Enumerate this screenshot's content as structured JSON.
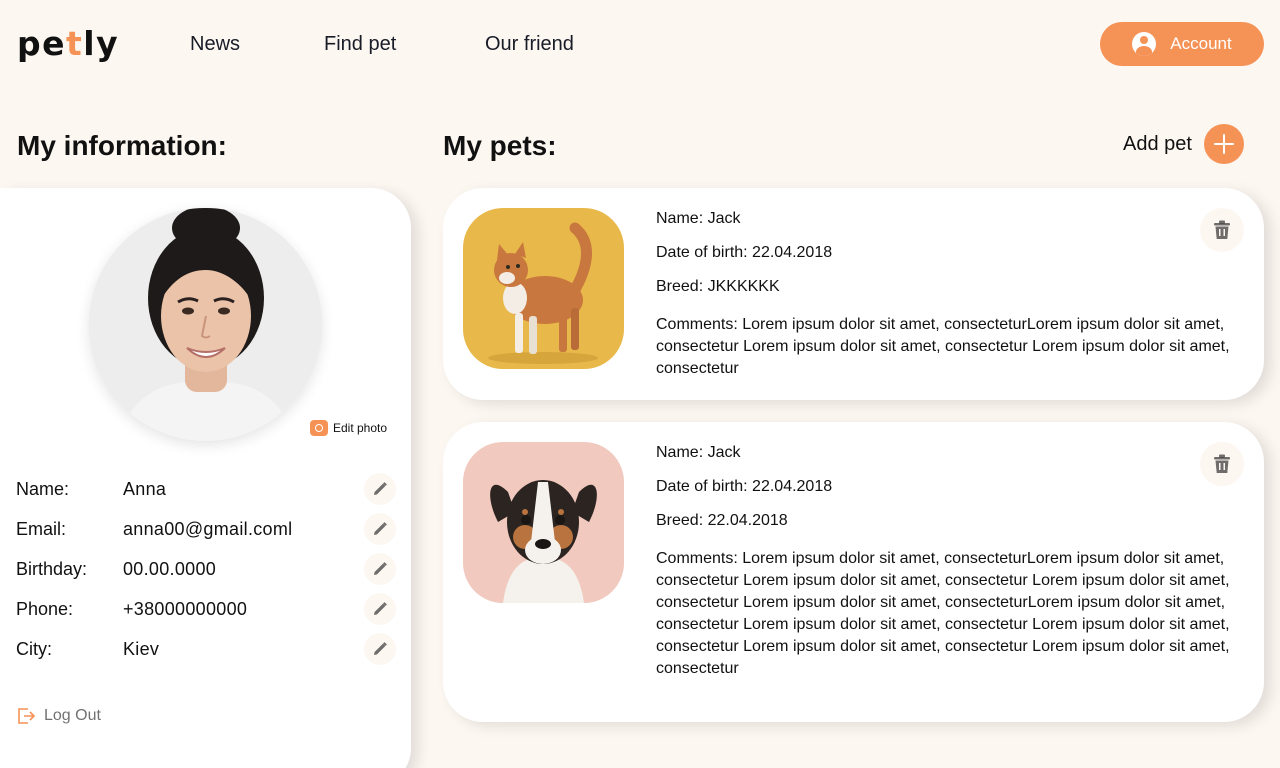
{
  "header": {
    "logo_prefix": "pe",
    "logo_accent": "t",
    "logo_suffix": "ly",
    "nav": [
      "News",
      "Find pet",
      "Our friend"
    ],
    "account_label": "Account"
  },
  "sections": {
    "info_title": "My information:",
    "pets_title": "My pets:",
    "add_pet_label": "Add pet"
  },
  "profile": {
    "edit_photo_label": "Edit photo",
    "fields": [
      {
        "label": "Name:",
        "value": "Anna"
      },
      {
        "label": "Email:",
        "value": "anna00@gmail.coml"
      },
      {
        "label": "Birthday:",
        "value": "00.00.0000"
      },
      {
        "label": "Phone:",
        "value": "+38000000000"
      },
      {
        "label": "City:",
        "value": "Kiev"
      }
    ],
    "logout_label": "Log Out"
  },
  "pets": [
    {
      "name_label": "Name",
      "name": ": Jack",
      "dob_label": "Date of birth",
      "dob": ": 22.04.2018",
      "breed_label": "Breed",
      "breed": ": JKKKKKK",
      "comments_label": "Comments",
      "comments": ": Lorem ipsum dolor sit amet, consecteturLorem ipsum dolor sit amet, consectetur  Lorem ipsum dolor sit amet, consectetur Lorem ipsum dolor sit amet, consectetur"
    },
    {
      "name_label": "Name",
      "name": ": Jack",
      "dob_label": "Date of birth",
      "dob": ": 22.04.2018",
      "breed_label": "Breed",
      "breed": ": 22.04.2018",
      "comments_label": "Comments",
      "comments": ": Lorem ipsum dolor sit amet, consecteturLorem ipsum dolor sit amet, consectetur  Lorem ipsum dolor sit amet, consectetur Lorem ipsum dolor sit amet, consectetur   Lorem ipsum dolor sit amet, consecteturLorem ipsum dolor sit amet, consectetur  Lorem ipsum dolor sit amet, consectetur Lorem ipsum dolor sit amet, consectetur   Lorem ipsum dolor sit amet, consectetur Lorem ipsum dolor sit amet, consectetur"
    }
  ],
  "colors": {
    "accent": "#F59256",
    "background": "#FDF7F2",
    "card": "#FFFFFF",
    "text": "#111111"
  },
  "icons": {
    "account": "user-circle-icon",
    "add": "plus-icon",
    "camera": "camera-icon",
    "edit": "pencil-icon",
    "logout": "logout-icon",
    "delete": "trash-icon"
  }
}
